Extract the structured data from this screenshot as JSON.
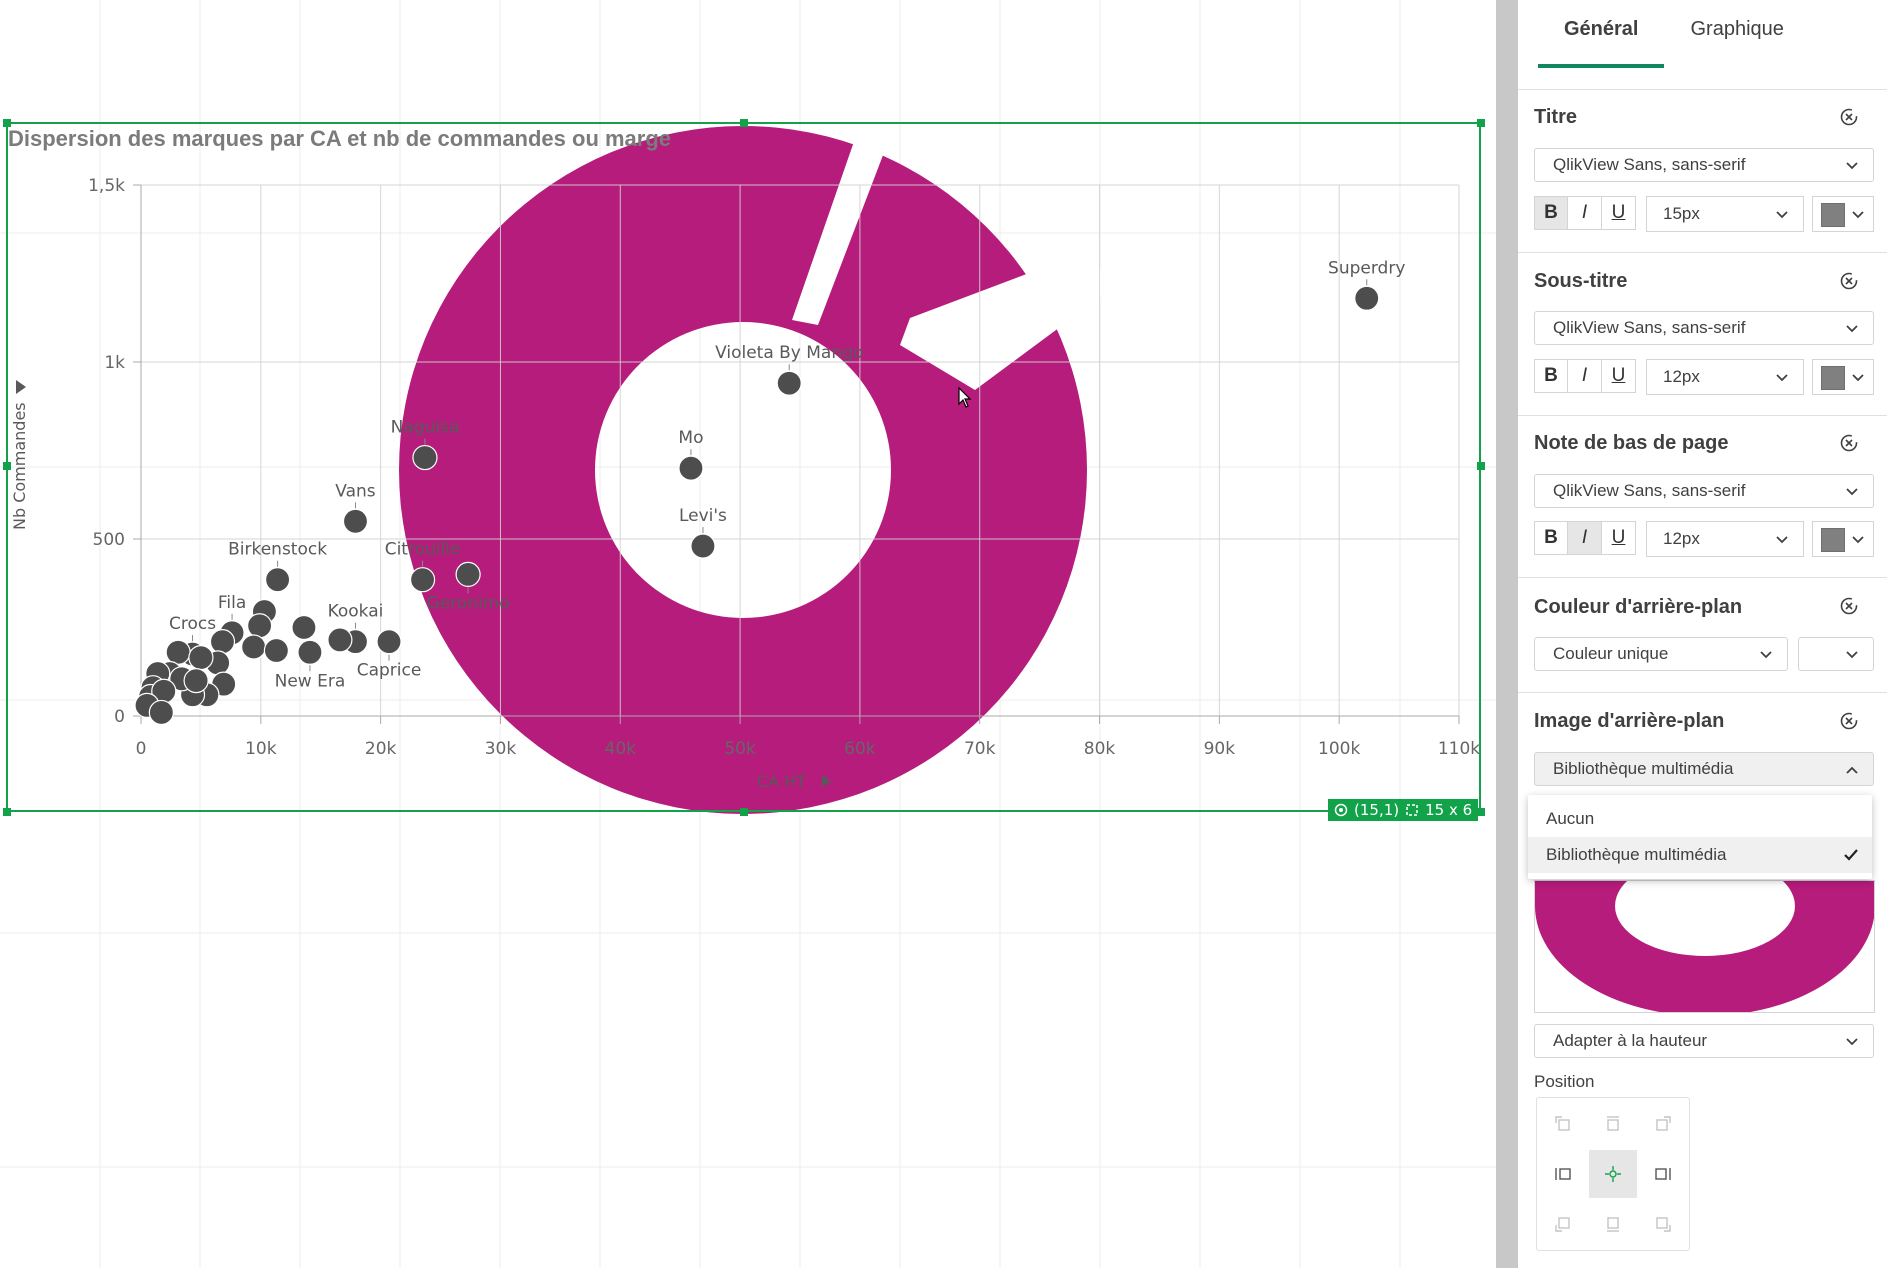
{
  "chart": {
    "title": "Dispersion des marques par CA et nb de commandes ou marge",
    "x_axis_title": "CA HT",
    "y_axis_title": "Nb Commandes",
    "status_cell": "(15,1)",
    "status_size": "15 x 6"
  },
  "chart_data": {
    "type": "scatter",
    "title": "Dispersion des marques par CA et nb de commandes ou marge",
    "xlabel": "CA HT",
    "ylabel": "Nb Commandes",
    "xlim": [
      0,
      110000
    ],
    "ylim": [
      0,
      1500
    ],
    "x_ticks": [
      "0",
      "10k",
      "20k",
      "30k",
      "40k",
      "50k",
      "60k",
      "70k",
      "80k",
      "90k",
      "100k",
      "110k"
    ],
    "y_ticks": [
      "0",
      "500",
      "1k",
      "1,5k"
    ],
    "grid": true,
    "background_image": "donut",
    "background_color": "#b51c7c",
    "point_color": "#4d4d4d",
    "points": [
      {
        "label": "Superdry",
        "x": 102300,
        "y": 1180
      },
      {
        "label": "Violeta By Mango",
        "x": 54100,
        "y": 940
      },
      {
        "label": "Mo",
        "x": 45900,
        "y": 700
      },
      {
        "label": "Levi's",
        "x": 46900,
        "y": 480
      },
      {
        "label": "Naguisa",
        "x": 23700,
        "y": 730
      },
      {
        "label": "Vans",
        "x": 17900,
        "y": 550
      },
      {
        "label": "Birkenstock",
        "x": 11400,
        "y": 385
      },
      {
        "label": "Citrouille",
        "x": 23500,
        "y": 385
      },
      {
        "label": "Geronimo",
        "x": 27300,
        "y": 400
      },
      {
        "label": "Fila",
        "x": 7600,
        "y": 235
      },
      {
        "label": "Crocs",
        "x": 4300,
        "y": 175
      },
      {
        "label": "Kookai",
        "x": 17900,
        "y": 210
      },
      {
        "label": "New Era",
        "x": 14100,
        "y": 180
      },
      {
        "label": "Caprice",
        "x": 20700,
        "y": 210
      },
      {
        "label": "",
        "x": 10300,
        "y": 295
      },
      {
        "label": "",
        "x": 9900,
        "y": 255
      },
      {
        "label": "",
        "x": 9400,
        "y": 195
      },
      {
        "label": "",
        "x": 11300,
        "y": 185
      },
      {
        "label": "",
        "x": 13600,
        "y": 250
      },
      {
        "label": "",
        "x": 16600,
        "y": 215
      },
      {
        "label": "",
        "x": 6800,
        "y": 210
      },
      {
        "label": "",
        "x": 6400,
        "y": 150
      },
      {
        "label": "",
        "x": 3100,
        "y": 180
      },
      {
        "label": "",
        "x": 5000,
        "y": 165
      },
      {
        "label": "",
        "x": 6900,
        "y": 90
      },
      {
        "label": "",
        "x": 5500,
        "y": 60
      },
      {
        "label": "",
        "x": 4300,
        "y": 60
      },
      {
        "label": "",
        "x": 2400,
        "y": 120
      },
      {
        "label": "",
        "x": 1400,
        "y": 120
      },
      {
        "label": "",
        "x": 3400,
        "y": 105
      },
      {
        "label": "",
        "x": 4600,
        "y": 100
      },
      {
        "label": "",
        "x": 1000,
        "y": 80
      },
      {
        "label": "",
        "x": 800,
        "y": 55
      },
      {
        "label": "",
        "x": 1900,
        "y": 70
      },
      {
        "label": "",
        "x": 500,
        "y": 30
      },
      {
        "label": "",
        "x": 1700,
        "y": 10
      }
    ]
  },
  "panel": {
    "tabs": [
      {
        "label": "Général",
        "active": true
      },
      {
        "label": "Graphique",
        "active": false
      }
    ],
    "sections": {
      "title": {
        "label": "Titre",
        "font": "QlikView Sans, sans-serif",
        "size": "15px",
        "bold": true,
        "italic": false,
        "underline": false,
        "color": "#808080"
      },
      "subtitle": {
        "label": "Sous-titre",
        "font": "QlikView Sans, sans-serif",
        "size": "12px",
        "bold": false,
        "italic": false,
        "underline": false,
        "color": "#808080"
      },
      "footnote": {
        "label": "Note de bas de page",
        "font": "QlikView Sans, sans-serif",
        "size": "12px",
        "bold": false,
        "italic": true,
        "underline": false,
        "color": "#808080"
      },
      "bg_color": {
        "label": "Couleur d'arrière-plan",
        "value": "Couleur unique"
      },
      "bg_image": {
        "label": "Image d'arrière-plan",
        "value": "Bibliothèque multimédia",
        "options": [
          "Aucun",
          "Bibliothèque multimédia"
        ],
        "selected_option": "Bibliothèque multimédia",
        "fit": "Adapter à la hauteur"
      },
      "position": {
        "label": "Position",
        "selected": "center"
      }
    },
    "format_buttons": {
      "bold": "B",
      "italic": "I",
      "underline": "U"
    }
  }
}
